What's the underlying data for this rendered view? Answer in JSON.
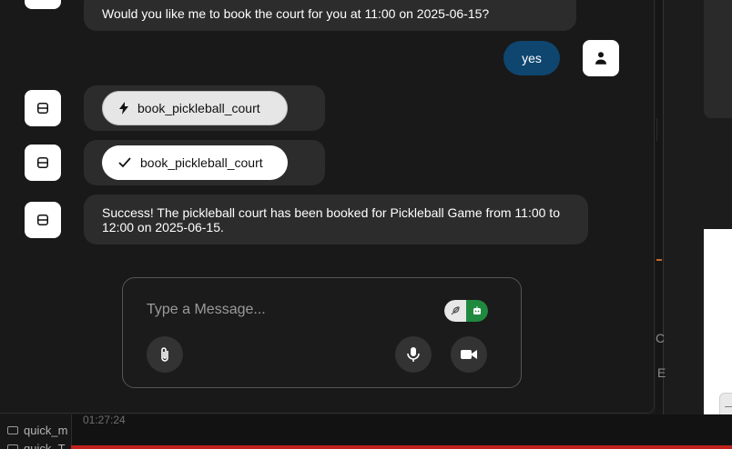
{
  "messages": {
    "assistant_question": "Would you like me to book the court for you at 11:00 on 2025-06-15?",
    "user_reply": "yes",
    "tool_call_label": "book_pickleball_court",
    "tool_result_label": "book_pickleball_court",
    "assistant_success": "Success! The pickleball court has been booked for Pickleball Game from 11:00 to 12:00 on 2025-06-15."
  },
  "composer": {
    "placeholder": "Type a Message..."
  },
  "icons": {
    "assistant_avatar": "robot-icon",
    "user_avatar": "person-icon",
    "tool_call": "lightning-icon",
    "tool_result": "check-icon",
    "attach": "paperclip-icon",
    "mic": "microphone-icon",
    "video": "video-camera-icon",
    "toggle_left": "feather-icon",
    "toggle_right": "robot-icon"
  },
  "colors": {
    "user_bubble": "#0e4670",
    "assistant_bubble": "#2c2c2c",
    "toggle_active": "#1f8a3f",
    "accent_red": "#c0221c"
  },
  "footer": {
    "timestamp": "01:27:24",
    "explorer_items": [
      "quick_m",
      "quick_T"
    ]
  },
  "side_panel": {
    "letters": [
      "C",
      "E"
    ]
  }
}
